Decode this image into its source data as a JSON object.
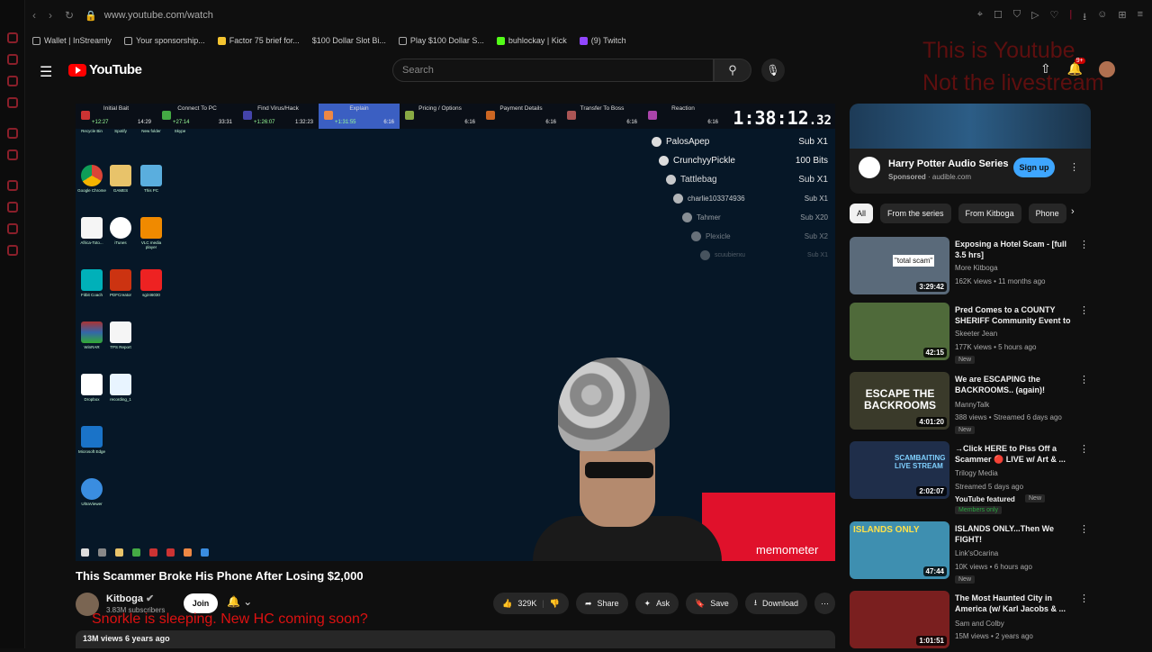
{
  "browser": {
    "url": "www.youtube.com/watch",
    "bookmarks": [
      "Wallet | InStreamly",
      "Your sponsorship...",
      "Factor 75 brief for...",
      "$100 Dollar Slot Bi...",
      "Play $100 Dollar S...",
      "buhlockay | Kick",
      "(9) Twitch"
    ]
  },
  "header": {
    "logo": "YouTube",
    "search_placeholder": "Search",
    "notif_count": "9+"
  },
  "overlay_text": {
    "line1": "This is Youtube",
    "line2": "Not the livestream"
  },
  "stream": {
    "steps": [
      {
        "label": "Initial Bait",
        "t1": "+12:27",
        "t2": "14:29"
      },
      {
        "label": "Connect To PC",
        "t1": "+27:14",
        "t2": "33:31"
      },
      {
        "label": "Find Virus/Hack",
        "t1": "+1:26:07",
        "t2": "1:32:23"
      },
      {
        "label": "Explain",
        "t1": "+1:31:55",
        "t2": "6:16"
      },
      {
        "label": "Pricing / Options",
        "t1": "",
        "t2": "6:16"
      },
      {
        "label": "Payment Details",
        "t1": "",
        "t2": "6:16"
      },
      {
        "label": "Transfer To Boss",
        "t1": "",
        "t2": "6:16"
      },
      {
        "label": "Reaction",
        "t1": "",
        "t2": "6:16"
      }
    ],
    "timer_main": "1:38:12",
    "timer_ms": ".32",
    "desktop_icons": [
      "Recycle Bin",
      "Spotify",
      "New folder",
      "Skype",
      "Google Chrome",
      "GAMES",
      "This PC",
      "Africa-Toto...",
      "iTunes",
      "VLC media player",
      "Fitbit Coach",
      "PDFCreator",
      "sg246030",
      "WinRAR",
      "TPS Report",
      "Dropbox",
      "recording_1",
      "Microsoft Edge",
      "UltraViewer"
    ],
    "subs": [
      {
        "name": "PalosApep",
        "val": "Sub X1"
      },
      {
        "name": "CrunchyyPickle",
        "val": "100 Bits"
      },
      {
        "name": "Tattlebag",
        "val": "Sub X1"
      },
      {
        "name": "charlie103374936",
        "val": "Sub X1"
      },
      {
        "name": "Tahmer",
        "val": "Sub X20"
      },
      {
        "name": "Plexicle",
        "val": "Sub X2"
      },
      {
        "name": "scuubierxu",
        "val": "Sub X1"
      }
    ],
    "watermark": "memometer"
  },
  "video": {
    "title": "This Scammer Broke His Phone After Losing $2,000",
    "channel": "Kitboga",
    "subscribers": "3.83M subscribers",
    "join": "Join",
    "likes": "329K",
    "share": "Share",
    "ask": "Ask",
    "save": "Save",
    "download": "Download",
    "overlay_caption": "Snorkle is sleeping. New HC coming soon?",
    "views": "13M views",
    "age": "6 years ago"
  },
  "ad": {
    "title": "Harry Potter Audio Series",
    "sponsored": "Sponsored",
    "domain": "audible.com",
    "cta": "Sign up"
  },
  "chips": [
    "All",
    "From the series",
    "From Kitboga",
    "Phone"
  ],
  "recommendations": [
    {
      "title": "Exposing a Hotel Scam - [full 3.5 hrs]",
      "channel": "More Kitboga",
      "meta": "162K views • 11 months ago",
      "duration": "3:29:42",
      "thumb_color": "#5a6a7a",
      "thumb_text": "\"total scam\"",
      "tag": ""
    },
    {
      "title": "Pred Comes to a COUNTY SHERIFF Community Event to ...",
      "channel": "Skeeter Jean",
      "meta": "177K views • 5 hours ago",
      "duration": "42:15",
      "thumb_color": "#4f6a3a",
      "thumb_text": "",
      "tag": "New"
    },
    {
      "title": "We are ESCAPING the BACKROOMS.. (again)!",
      "channel": "MannyTalk",
      "meta": "388 views • Streamed 6 days ago",
      "duration": "4:01:20",
      "thumb_color": "#3a3a2a",
      "thumb_text": "ESCAPE THE BACKROOMS",
      "tag": "New"
    },
    {
      "title": "→Click HERE to Piss Off a Scammer 🔴 LIVE w/ Art & ...",
      "channel": "Trilogy Media",
      "meta": "Streamed 5 days ago",
      "duration": "2:02:07",
      "thumb_color": "#1f2e4a",
      "thumb_text": "SCAMBAITING LIVE STREAM",
      "tag": "YouTube featured",
      "tag2": "New",
      "members": "Members only"
    },
    {
      "title": "ISLANDS ONLY...Then We FIGHT!",
      "channel": "Link'sOcarina",
      "meta": "10K views • 6 hours ago",
      "duration": "47:44",
      "thumb_color": "#3e8fb0",
      "thumb_text": "ISLANDS ONLY",
      "tag": "New"
    },
    {
      "title": "The Most Haunted City in America (w/ Karl Jacobs & ...",
      "channel": "Sam and Colby",
      "meta": "15M views • 2 years ago",
      "duration": "1:01:51",
      "thumb_color": "#7a1f1f",
      "thumb_text": "",
      "tag": ""
    }
  ]
}
